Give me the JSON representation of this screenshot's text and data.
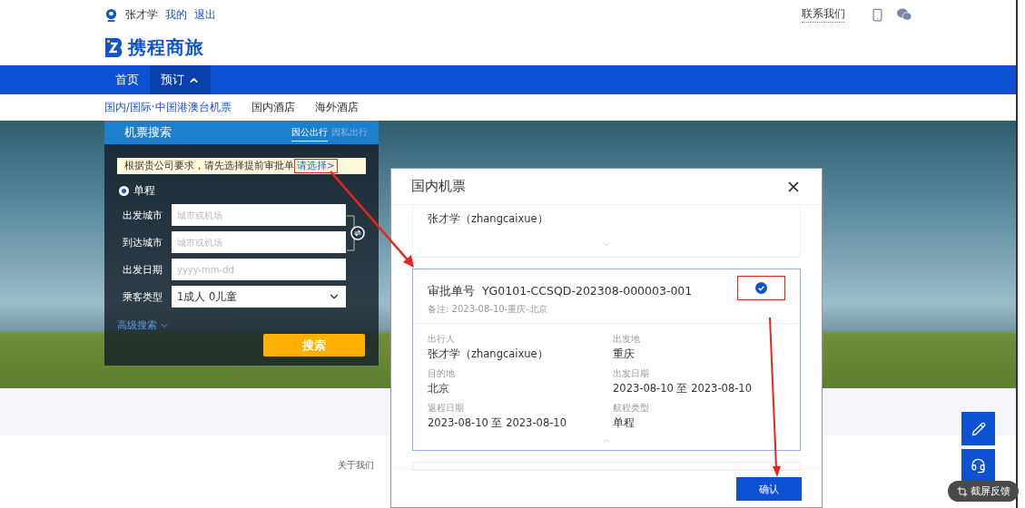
{
  "user_bar": {
    "user_name": "张才学",
    "links": [
      "我的",
      "退出"
    ],
    "contact": "联系我们"
  },
  "logo": {
    "text": "携程商旅"
  },
  "nav": {
    "items": [
      {
        "label": "首页",
        "selected": false,
        "expanded": false
      },
      {
        "label": "预订",
        "selected": true,
        "expanded": true
      }
    ]
  },
  "sub_nav": {
    "items": [
      {
        "label": "国内/国际·中国港澳台机票",
        "selected": true
      },
      {
        "label": "国内酒店",
        "selected": false
      },
      {
        "label": "海外酒店",
        "selected": false
      }
    ]
  },
  "search_panel": {
    "title": "机票搜索",
    "tabs": [
      {
        "label": "因公出行",
        "selected": true
      },
      {
        "label": "因私出行",
        "selected": false
      }
    ],
    "notice": "根据贵公司要求，请先选择提前审批单",
    "notice_link": "请选择>",
    "trip_options": [
      {
        "label": "单程",
        "selected": true
      }
    ],
    "fields": [
      {
        "kind": "input",
        "label": "出发城市",
        "placeholder": "城市或机场"
      },
      {
        "kind": "input",
        "label": "到达城市",
        "placeholder": "城市或机场"
      },
      {
        "kind": "input",
        "label": "出发日期",
        "placeholder": "yyyy-mm-dd"
      },
      {
        "kind": "select",
        "label": "乘客类型",
        "value": "1成人  0儿童"
      }
    ],
    "advanced": "高级搜索",
    "search_button": "搜索"
  },
  "footer": {
    "links": [
      "关于我们"
    ]
  },
  "modal": {
    "title": "国内机票",
    "cards": [
      {
        "kind": "partial",
        "selected": false,
        "traveler": "张才学（zhangcaixue）"
      },
      {
        "kind": "full",
        "selected": true,
        "expanded": true,
        "number_label": "审批单号",
        "number": "YG0101-CCSQD-202308-000003-001",
        "note": "备注: 2023-08-10-重庆-北京",
        "details": [
          {
            "label": "出行人",
            "value": "张才学（zhangcaixue）"
          },
          {
            "label": "出发地",
            "value": "重庆"
          },
          {
            "label": "目的地",
            "value": "北京"
          },
          {
            "label": "出发日期",
            "value": "2023-08-10 至 2023-08-10"
          },
          {
            "label": "返程日期",
            "value": "2023-08-10 至 2023-08-10"
          },
          {
            "label": "航程类型",
            "value": "单程"
          }
        ]
      },
      {
        "kind": "empty",
        "selected": false
      }
    ],
    "confirm": "确认"
  },
  "feedback": {
    "label": "截屏反馈"
  }
}
